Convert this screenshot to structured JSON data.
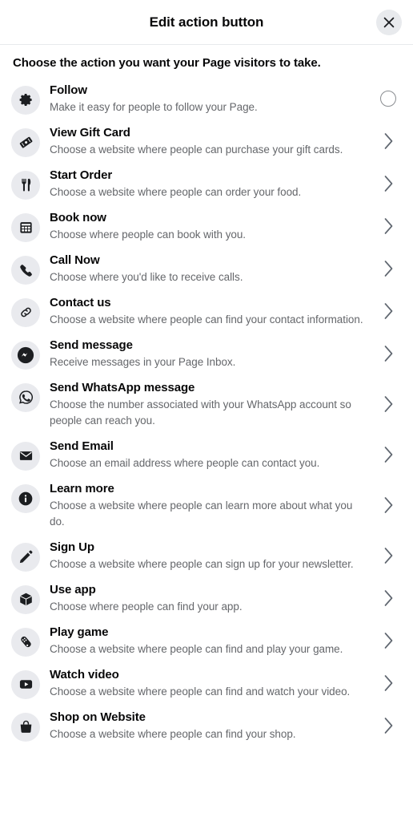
{
  "header": {
    "title": "Edit action button",
    "close_label": "Close",
    "close_icon": "close-icon"
  },
  "body": {
    "prompt": "Choose the action you want your Page visitors to take."
  },
  "colors": {
    "background": "#ffffff",
    "title_text": "#080809",
    "description_text": "#65676b",
    "icon_badge_bg": "#e9eaee",
    "divider": "#e8eaed",
    "control": "#606770",
    "radio_border": "#8a8d91",
    "close_bg": "#e8eaed"
  },
  "actions": [
    {
      "title": "Follow",
      "description": "Make it easy for people to follow your Page.",
      "icon": "gear-icon",
      "control": "radio-unselected"
    },
    {
      "title": "View Gift Card",
      "description": "Choose a website where people can purchase your gift cards.",
      "icon": "gift-card-icon",
      "control": "chevron-right"
    },
    {
      "title": "Start Order",
      "description": "Choose a website where people can order your food.",
      "icon": "fork-knife-icon",
      "control": "chevron-right"
    },
    {
      "title": "Book now",
      "description": "Choose where people can book with you.",
      "icon": "calendar-icon",
      "control": "chevron-right"
    },
    {
      "title": "Call Now",
      "description": "Choose where you'd like to receive calls.",
      "icon": "phone-icon",
      "control": "chevron-right"
    },
    {
      "title": "Contact us",
      "description": "Choose a website where people can find your contact information.",
      "icon": "link-icon",
      "control": "chevron-right"
    },
    {
      "title": "Send message",
      "description": "Receive messages in your Page Inbox.",
      "icon": "messenger-icon",
      "control": "chevron-right"
    },
    {
      "title": "Send WhatsApp message",
      "description": "Choose the number associated with your WhatsApp account so people can reach you.",
      "icon": "whatsapp-icon",
      "control": "chevron-right"
    },
    {
      "title": "Send Email",
      "description": "Choose an email address where people can contact you.",
      "icon": "envelope-icon",
      "control": "chevron-right"
    },
    {
      "title": "Learn more",
      "description": "Choose a website where people can learn more about what you do.",
      "icon": "info-icon",
      "control": "chevron-right"
    },
    {
      "title": "Sign Up",
      "description": "Choose a website where people can sign up for your newsletter.",
      "icon": "pencil-icon",
      "control": "chevron-right"
    },
    {
      "title": "Use app",
      "description": "Choose where people can find your app.",
      "icon": "cube-icon",
      "control": "chevron-right"
    },
    {
      "title": "Play game",
      "description": "Choose a website where people can find and play your game.",
      "icon": "game-controller-icon",
      "control": "chevron-right"
    },
    {
      "title": "Watch video",
      "description": "Choose a website where people can find and watch your video.",
      "icon": "video-play-icon",
      "control": "chevron-right"
    },
    {
      "title": "Shop on Website",
      "description": "Choose a website where people can find your shop.",
      "icon": "shopping-bag-icon",
      "control": "chevron-right"
    }
  ]
}
